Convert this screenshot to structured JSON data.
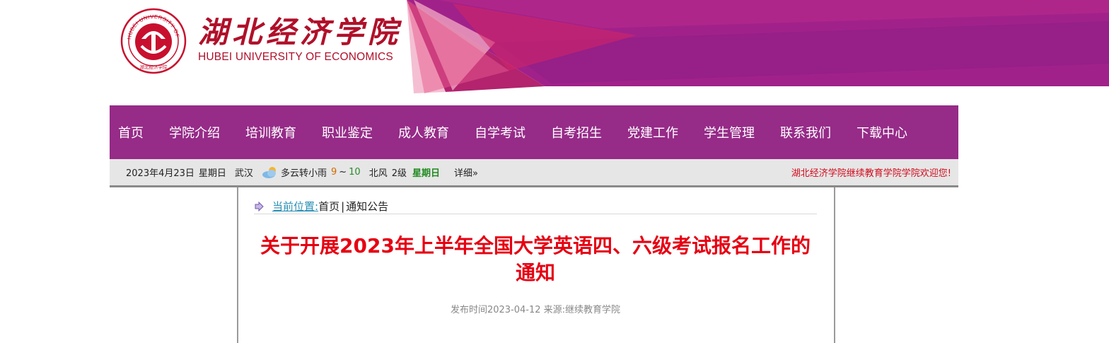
{
  "header": {
    "school_name_cn": "湖北经济学院",
    "school_name_en": "HUBEI UNIVERSITY OF ECONOMICS",
    "seal_ring_text": "HUBEI UNIVERSITY OF ECONOMICS",
    "seal_bottom_text": "湖北经济学院",
    "brand_color": "#b0102a"
  },
  "nav": {
    "bg_color": "#962b88",
    "items": [
      {
        "label": "首页"
      },
      {
        "label": "学院介绍"
      },
      {
        "label": "培训教育"
      },
      {
        "label": "职业鉴定"
      },
      {
        "label": "成人教育"
      },
      {
        "label": "自学考试"
      },
      {
        "label": "自考招生"
      },
      {
        "label": "党建工作"
      },
      {
        "label": "学生管理"
      },
      {
        "label": "联系我们"
      },
      {
        "label": "下载中心"
      }
    ]
  },
  "infobar": {
    "date": "2023年4月23日",
    "weekday": "星期日",
    "city": "武汉",
    "weather_icon": "cloud-sun-icon",
    "weather": "多云转小雨",
    "temp_low": "9",
    "temp_sep": "~",
    "temp_high": "10",
    "wind": "北风",
    "wind_level": "2级",
    "weekday_highlight": "星期日",
    "detail_label": "详细»",
    "welcome": "湖北经济学院继续教育学院学院欢迎您!"
  },
  "breadcrumb": {
    "icon": "arrow-right-icon",
    "label": "当前位置:",
    "home": "首页",
    "sep": "|",
    "current": "通知公告"
  },
  "article": {
    "title": "关于开展2023年上半年全国大学英语四、六级考试报名工作的通知",
    "meta": "发布时间2023-04-12 来源:继续教育学院"
  }
}
